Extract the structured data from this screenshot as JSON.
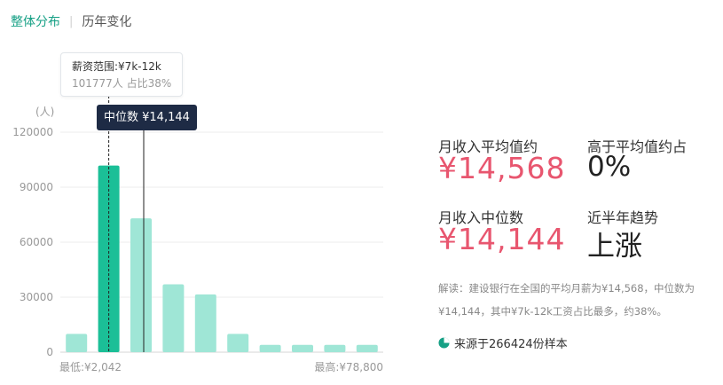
{
  "tabs": {
    "active": "整体分布",
    "other": "历年变化"
  },
  "tooltip": {
    "range": "薪资范围:¥7k-12k",
    "detail": "101777人  占比38%"
  },
  "median_label": "中位数 ¥14,144",
  "stats": {
    "avg_label": "月收入平均值约",
    "avg_value": "¥14,568",
    "above_label": "高于平均值约占",
    "above_value": "0%",
    "median_label": "月收入中位数",
    "median_value": "¥14,144",
    "trend_label": "近半年趋势",
    "trend_value": "上涨"
  },
  "description": "解读：建设银行在全国的平均月薪为¥14,568，中位数为¥14,144，其中¥7k-12k工资占比最多，约38%。",
  "source": "来源于266424份样本",
  "colors": {
    "bar": "#9fe6d6",
    "bar_highlight": "#1bbf97",
    "accent": "#16a085",
    "red": "#e8566f",
    "dark": "#1e2b45"
  },
  "chart_data": {
    "type": "bar",
    "ylabel": "(人)",
    "yticks": [
      0,
      30000,
      60000,
      90000,
      120000
    ],
    "ylim": [
      0,
      120000
    ],
    "values": [
      10000,
      101777,
      73000,
      37000,
      31500,
      10000,
      4000,
      4000,
      4000,
      4000
    ],
    "highlight_index": 1,
    "x_min_label": "最低:¥2,042",
    "x_max_label": "最高:¥78,800"
  }
}
